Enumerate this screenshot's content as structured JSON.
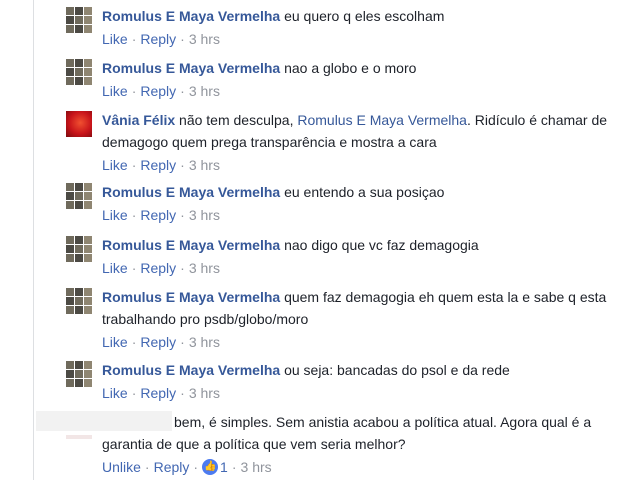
{
  "comments": [
    {
      "author": "Romulus E Maya Vermelha",
      "text": "eu quero q eles escolham",
      "like": "Like",
      "reply": "Reply",
      "time": "3 hrs"
    },
    {
      "author": "Romulus E Maya Vermelha",
      "text": "nao a globo e o moro",
      "like": "Like",
      "reply": "Reply",
      "time": "3 hrs"
    },
    {
      "author": "Vânia Félix",
      "text_before": "não tem desculpa, ",
      "mention": "Romulus E Maya Vermelha",
      "text_after": ". Ridículo é chamar de demagogo quem prega transparência e mostra a cara",
      "like": "Like",
      "reply": "Reply",
      "time": "3 hrs"
    },
    {
      "author": "Romulus E Maya Vermelha",
      "text": "eu entendo a sua posiçao",
      "like": "Like",
      "reply": "Reply",
      "time": "3 hrs"
    },
    {
      "author": "Romulus E Maya Vermelha",
      "text": "nao digo que vc faz demagogia",
      "like": "Like",
      "reply": "Reply",
      "time": "3 hrs"
    },
    {
      "author": "Romulus E Maya Vermelha",
      "text": "quem faz demagogia eh quem esta la e sabe q esta trabalhando pro psdb/globo/moro",
      "like": "Like",
      "reply": "Reply",
      "time": "3 hrs"
    },
    {
      "author": "Romulus E Maya Vermelha",
      "text": "ou seja: bancadas do psol e da rede",
      "like": "Like",
      "reply": "Reply",
      "time": "3 hrs"
    },
    {
      "text": "bem, é simples. Sem anistia acabou a política atual. Agora qual é a garantia de que a política que vem seria melhor?",
      "like": "Unlike",
      "reply": "Reply",
      "reactions": "1",
      "time": "3 hrs"
    }
  ]
}
